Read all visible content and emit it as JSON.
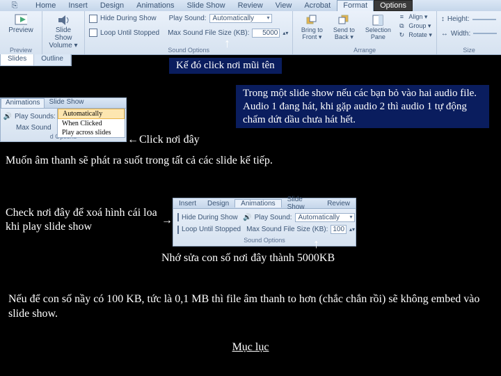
{
  "ribbon": {
    "tabs": [
      "Home",
      "Insert",
      "Design",
      "Animations",
      "Slide Show",
      "Review",
      "View",
      "Acrobat",
      "Format",
      "Options"
    ],
    "preview": "Preview",
    "slideshow_vol": "Slide Show\nVolume ▾",
    "hide_during": "Hide During Show",
    "loop_until": "Loop Until Stopped",
    "play_sound": "Play Sound:",
    "auto": "Automatically",
    "max_size": "Max Sound File Size (KB):",
    "max_val": "5000",
    "sound_options": "Sound Options",
    "bring_front": "Bring to\nFront ▾",
    "send_back": "Send to\nBack ▾",
    "selection_pane": "Selection\nPane",
    "align": "Align ▾",
    "group_lbl": "Group ▾",
    "rotate": "Rotate ▾",
    "arrange": "Arrange",
    "height": "Height:",
    "width": "Width:",
    "size": "Size",
    "slides": "Slides",
    "outline": "Outline"
  },
  "callout1": "Kế đó click nơi mũi tên",
  "callout2": "Trong một slide show nếu các bạn bỏ vào hai audio file. Audio 1 đang hát, khi gặp audio 2 thì audio 1 tự động chấm dứt dầu chưa hát hết.",
  "click_here": "Click nơi đây",
  "line1": "Muốn âm thanh sẽ phát ra suốt trong tất cả các slide kế tiếp.",
  "check_here": "Check nơi đây để xoá hình cái loa khi play slide show",
  "remember": "Nhớ sửa con số nơi đây thành 5000KB",
  "line2": "Nếu để con số nầy có 100 KB, tức là 0,1 MB thì file âm thanh to hơn (chắc chắn rồi)  sẽ không embed vào slide show.",
  "toc": "Mục lục",
  "panel2": {
    "tabs": [
      "Animations",
      "Slide Show"
    ],
    "play_sounds": "Play Sounds:",
    "auto": "Automatically",
    "max_sound": "Max Sound",
    "options": "d Options",
    "list": [
      "Automatically",
      "When Clicked",
      "Play across slides"
    ]
  },
  "panel3": {
    "tabs": [
      "Insert",
      "Design",
      "Animations",
      "Slide Show",
      "Review"
    ],
    "hide": "Hide During Show",
    "loop": "Loop Until Stopped",
    "play": "Play Sound:",
    "auto": "Automatically",
    "max": "Max Sound File Size (KB):",
    "val": "100",
    "grp": "Sound Options"
  }
}
